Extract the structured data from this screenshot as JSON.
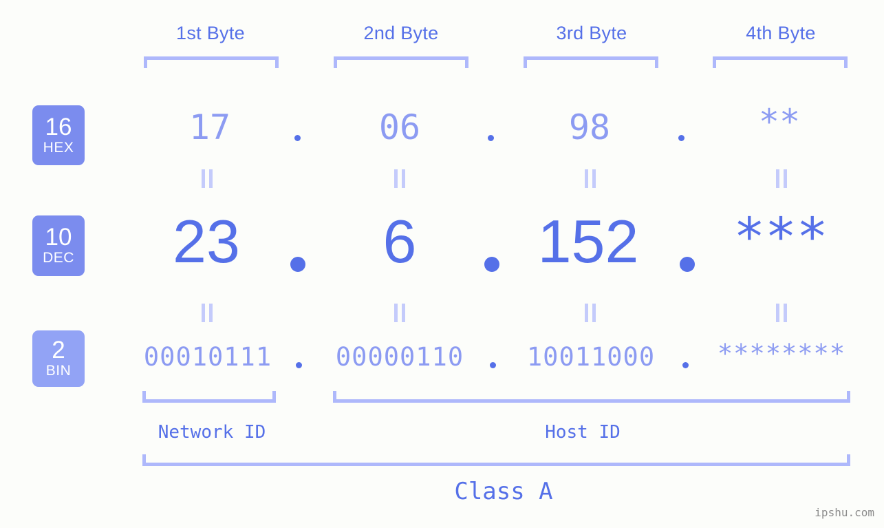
{
  "meta": {
    "background": "#fcfdfa",
    "accent": "#5570e8",
    "accent_light": "#8c9bf2",
    "accent_pale": "#aeb8fb",
    "badge_dark": "#7b8cee",
    "badge_light": "#92a3f5",
    "watermark": "ipshu.com"
  },
  "headers": [
    {
      "label": "1st Byte"
    },
    {
      "label": "2nd Byte"
    },
    {
      "label": "3rd Byte"
    },
    {
      "label": "4th Byte"
    }
  ],
  "bases": [
    {
      "number": "16",
      "name": "HEX"
    },
    {
      "number": "10",
      "name": "DEC"
    },
    {
      "number": "2",
      "name": "BIN"
    }
  ],
  "rows": {
    "hex": {
      "base": "16",
      "name": "HEX",
      "values": [
        "17",
        "06",
        "98",
        "**"
      ]
    },
    "dec": {
      "base": "10",
      "name": "DEC",
      "values": [
        "23",
        "6",
        "152",
        "***"
      ]
    },
    "bin": {
      "base": "2",
      "name": "BIN",
      "values": [
        "00010111",
        "00000110",
        "10011000",
        "********"
      ]
    }
  },
  "separators": {
    "hex": [
      ".",
      ".",
      "."
    ],
    "dec": [
      ".",
      ".",
      "."
    ],
    "bin": [
      ".",
      ".",
      "."
    ]
  },
  "equals_marker": "=",
  "sections": [
    {
      "label": "Network ID"
    },
    {
      "label": "Host ID"
    }
  ],
  "class": {
    "label": "Class A"
  },
  "address": {
    "hex": "17.06.98.**",
    "dec": "23.6.152.***",
    "bin": "00010111.00000110.10011000.********"
  }
}
